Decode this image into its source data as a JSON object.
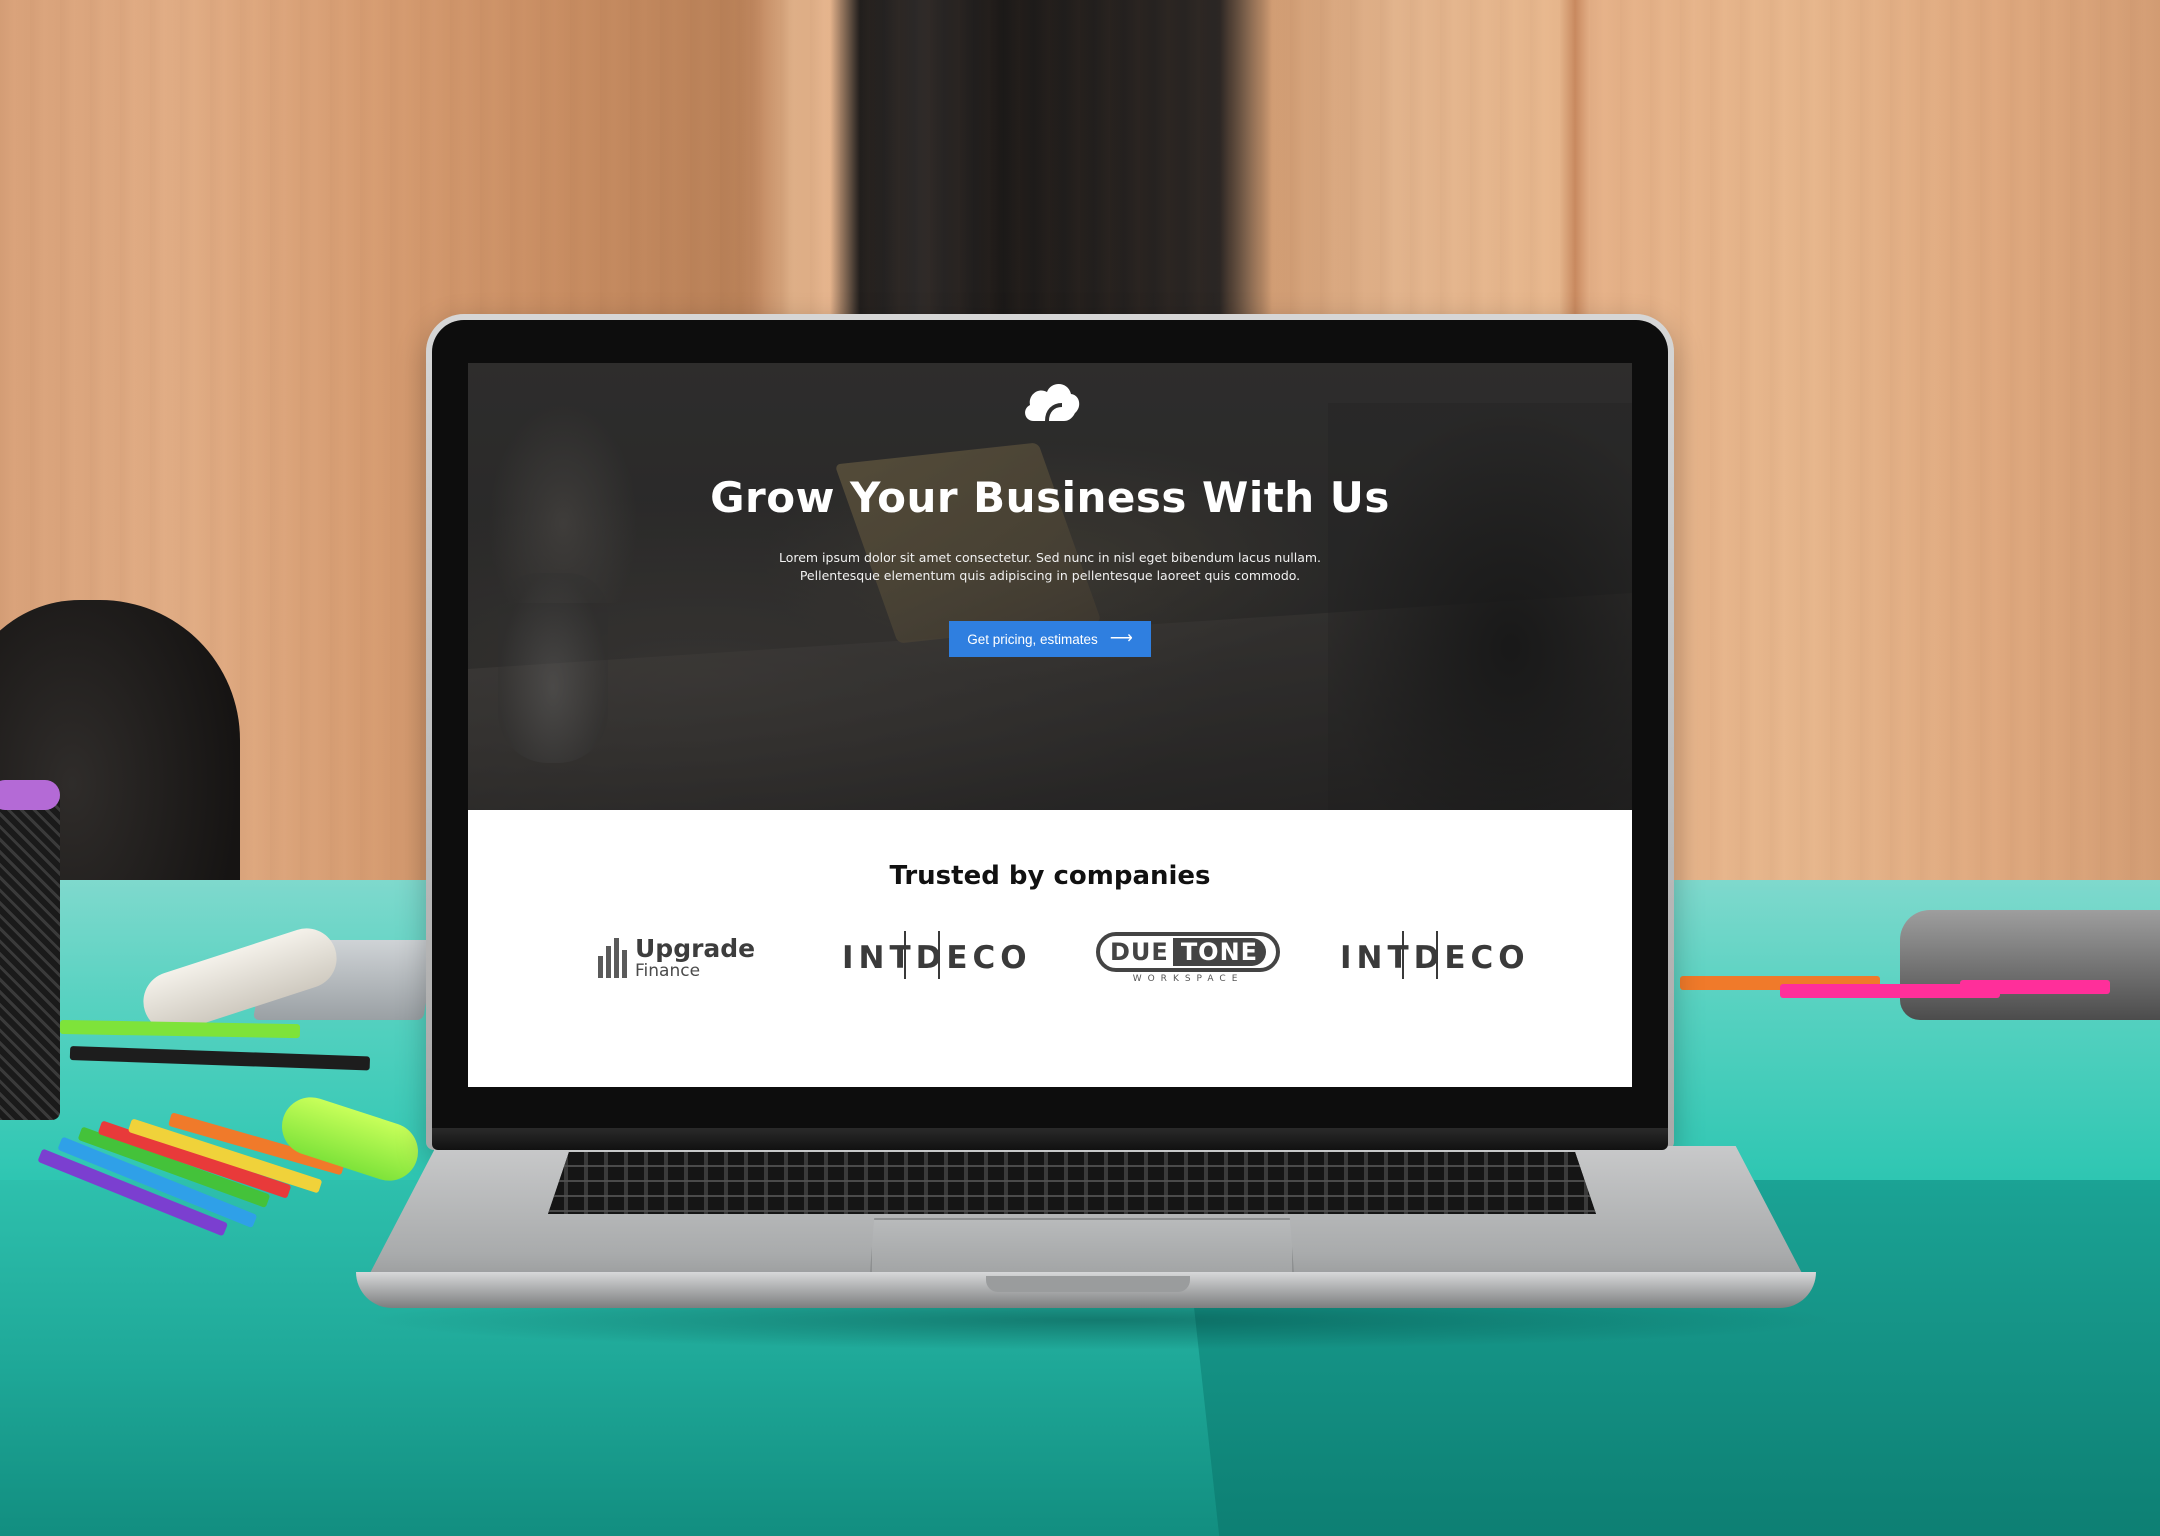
{
  "hero": {
    "logo_icon": "cloud-icon",
    "title": "Grow Your Business With Us",
    "description": "Lorem ipsum dolor sit amet consectetur. Sed nunc in nisl eget bibendum lacus nullam. Pellentesque elementum quis adipiscing in pellentesque laoreet quis commodo.",
    "cta_label": "Get pricing, estimates",
    "cta_icon": "arrow-right-icon",
    "cta_color": "#2f7fe0"
  },
  "trusted": {
    "title": "Trusted by companies",
    "logos": [
      {
        "name": "Upgrade",
        "subtitle": "Finance"
      },
      {
        "name": "INTDECO"
      },
      {
        "name_part1": "DUE",
        "name_part2": "TONE",
        "subtitle": "WORKSPACE"
      },
      {
        "name": "INTDECO"
      }
    ]
  }
}
